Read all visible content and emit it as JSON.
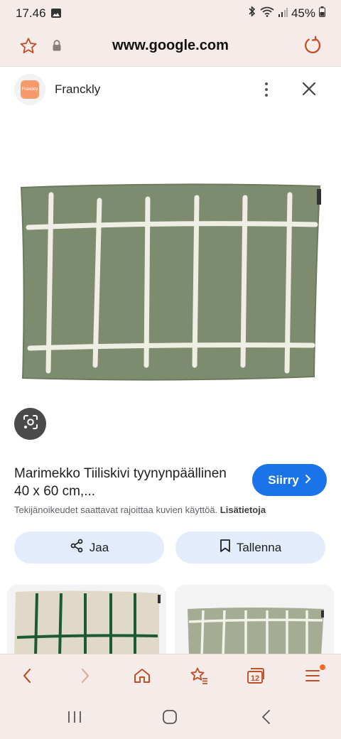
{
  "status_bar": {
    "time": "17.46",
    "battery": "45%"
  },
  "browser": {
    "url": "www.google.com"
  },
  "source": {
    "name": "Franckly",
    "logo_text": "Franckly"
  },
  "product": {
    "title": "Marimekko Tiiliskivi tyynynpäällinen 40 x 60 cm,...",
    "visit_label": "Siirry",
    "copyright_text": "Tekijänoikeudet saattavat rajoittaa kuvien käyttöä.",
    "more_info_label": "Lisätietoja"
  },
  "actions": {
    "share_label": "Jaa",
    "save_label": "Tallenna"
  },
  "bottom_nav": {
    "tabs_count": "12"
  },
  "colors": {
    "accent": "#1a73e8",
    "chrome_bg": "#f5ecea",
    "browser_icon": "#c0502a",
    "pillow_green": "#7d8b6e"
  }
}
